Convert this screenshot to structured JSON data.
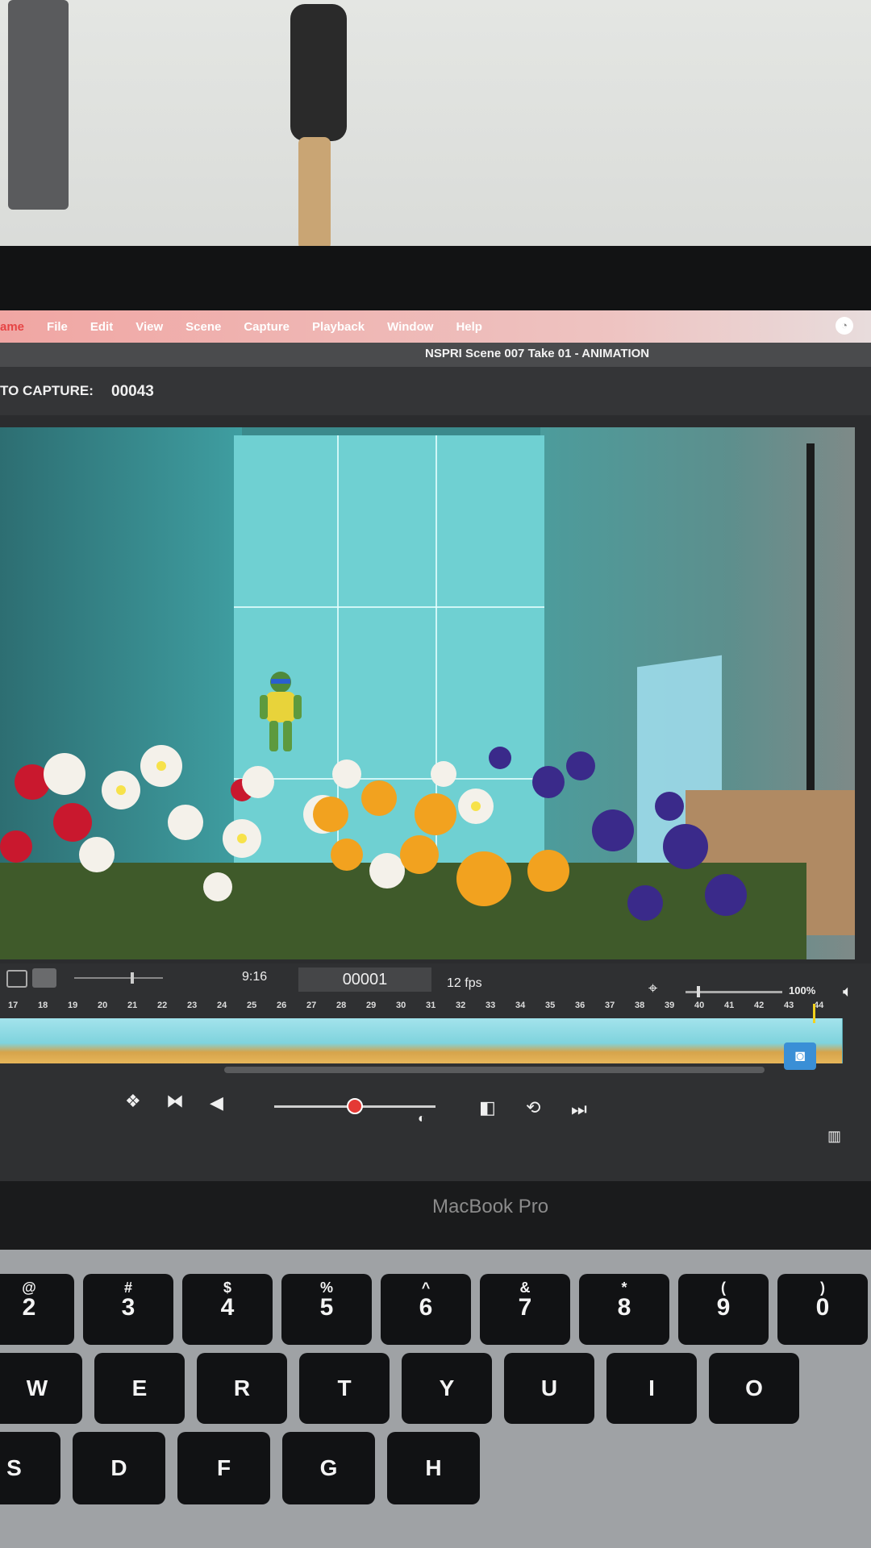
{
  "menu": {
    "items": [
      "ame",
      "File",
      "Edit",
      "View",
      "Scene",
      "Capture",
      "Playback",
      "Window",
      "Help"
    ]
  },
  "window": {
    "title": "NSPRI  Scene 007  Take 01 - ANIMATION"
  },
  "capture": {
    "label": "TO CAPTURE:",
    "value": "00043"
  },
  "timeline": {
    "duration": "9:16",
    "current_frame": "00001",
    "fps": "12 fps",
    "zoom": "100%",
    "ruler_ticks": [
      "17",
      "18",
      "19",
      "20",
      "21",
      "22",
      "23",
      "24",
      "25",
      "26",
      "27",
      "28",
      "29",
      "30",
      "31",
      "32",
      "33",
      "34",
      "35",
      "36",
      "37",
      "38",
      "39",
      "40",
      "41",
      "42",
      "43",
      "44"
    ],
    "thumbnail_count": 29,
    "playhead_slider_level": 0.5
  },
  "hardware": {
    "brand_label": "MacBook Pro"
  },
  "keyboard": {
    "number_row": [
      {
        "sub": "@",
        "main": "2"
      },
      {
        "sub": "#",
        "main": "3"
      },
      {
        "sub": "$",
        "main": "4"
      },
      {
        "sub": "%",
        "main": "5"
      },
      {
        "sub": "^",
        "main": "6"
      },
      {
        "sub": "&",
        "main": "7"
      },
      {
        "sub": "*",
        "main": "8"
      },
      {
        "sub": "(",
        "main": "9"
      },
      {
        "sub": ")",
        "main": "0"
      }
    ],
    "row2": [
      "W",
      "E",
      "R",
      "T",
      "Y",
      "U",
      "I",
      "O"
    ],
    "row3": [
      "S",
      "D",
      "F",
      "G",
      "H"
    ]
  },
  "colors": {
    "menubar": "#f0a6a3",
    "record_dot": "#e53935",
    "camera_button": "#3a8fd6",
    "screen_bg": "#2b2c2e",
    "teal_backdrop": "#6fd0d2"
  }
}
